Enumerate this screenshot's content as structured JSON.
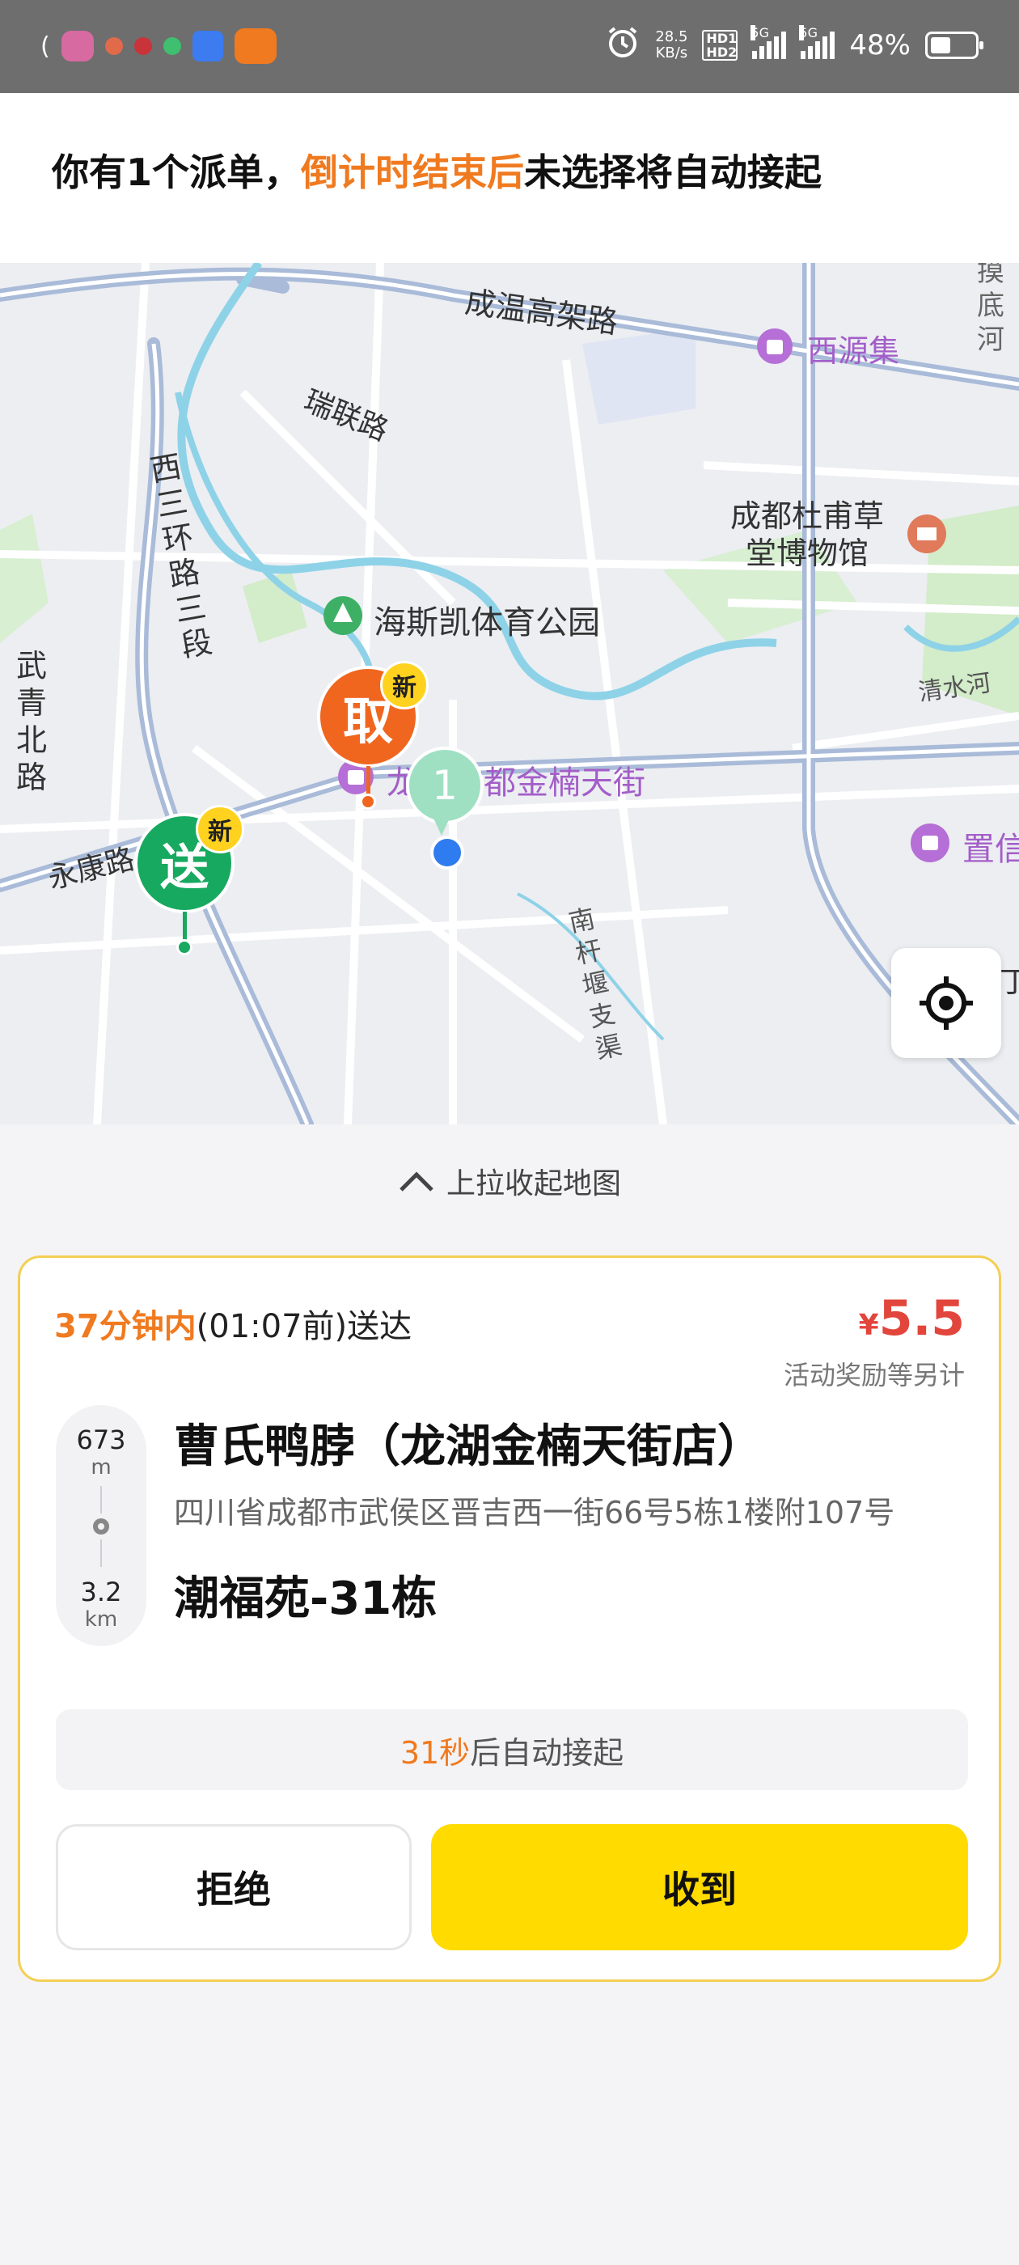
{
  "status_bar": {
    "network_speed_value": "28.5",
    "network_speed_unit": "KB/s",
    "hd_label": "HD1 HD2",
    "signal_1_label": "5G",
    "signal_2_label": "5G",
    "battery_percent": "48%",
    "alarm_icon": "alarm-clock-icon"
  },
  "notice": {
    "prefix": "你有1个派单，",
    "highlight": "倒计时结束后",
    "suffix": "未选择将自动接起"
  },
  "map": {
    "labels": {
      "road_chengwen": "成温高架路",
      "road_ruilian": "瑞联路",
      "road_west_ring": "西三环路三段",
      "road_wuqing": "武青北路",
      "road_yongkang": "永康路",
      "canal": "南杆堰支渠",
      "river": "清水河",
      "poi_xiyuanji": "西源集",
      "poi_dufu": "成都杜甫草堂博物馆",
      "poi_park": "海斯凯体育公园",
      "poi_jinnan": "龙湖成都金楠天街",
      "poi_partial_right": "置信",
      "poi_partial_edge": "丁",
      "poi_top_right": "摸底河"
    },
    "markers": {
      "pickup_label": "取",
      "pickup_badge": "新",
      "dropoff_label": "送",
      "dropoff_badge": "新",
      "rider_number": "1"
    },
    "colors": {
      "pickup": "#f0661f",
      "dropoff": "#17a95f",
      "rider": "#9fe0c3",
      "badge": "#ffd21f",
      "poi_purple": "#b56fd6",
      "location_dot": "#2f7bf0"
    }
  },
  "pull_hint": {
    "icon": "chevron-up-icon",
    "label": "上拉收起地图"
  },
  "order": {
    "deliver_within": "37分钟内",
    "deliver_deadline": "(01:07前)送达",
    "price_currency": "¥",
    "price_value": "5.5",
    "price_note": "活动奖励等另计",
    "distance_to_shop_value": "673",
    "distance_to_shop_unit": "m",
    "distance_to_dest_value": "3.2",
    "distance_to_dest_unit": "km",
    "shop_name": "曹氏鸭脖（龙湖金楠天街店）",
    "shop_address": "四川省成都市武侯区晋吉西一街66号5栋1楼附107号",
    "destination_name": "潮福苑-31栋",
    "auto_accept_seconds": "31秒",
    "auto_accept_text": "后自动接起",
    "reject_label": "拒绝",
    "accept_label": "收到",
    "accent_color": "#ffdb00",
    "card_border_color": "#f3cf53"
  }
}
